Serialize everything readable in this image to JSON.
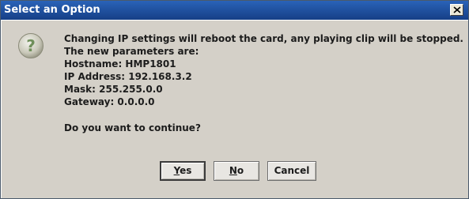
{
  "window": {
    "title": "Select an Option",
    "close_glyph": "×"
  },
  "icon": {
    "name": "question-icon",
    "glyph": "?"
  },
  "message": {
    "lines": [
      "Changing IP settings will reboot the card, any playing clip will be stopped.",
      "The new parameters are:",
      "Hostname: HMP1801",
      "IP Address: 192.168.3.2",
      "Mask: 255.255.0.0",
      "Gateway: 0.0.0.0"
    ],
    "question": "Do you want to continue?"
  },
  "buttons": {
    "yes": {
      "mnemonic": "Y",
      "rest": "es"
    },
    "no": {
      "mnemonic": "N",
      "rest": "o"
    },
    "cancel": {
      "label": "Cancel"
    }
  },
  "colors": {
    "titlebar": "#1a4f9e",
    "dialog_bg": "#d4d0c8"
  }
}
